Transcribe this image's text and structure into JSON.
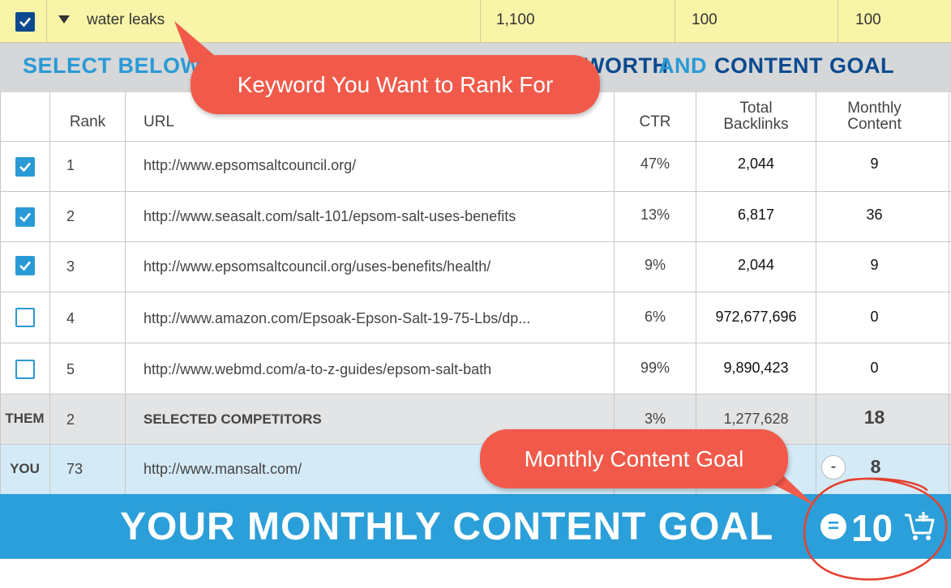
{
  "keyword_row": {
    "keyword": "water leaks",
    "search_volume": "1,100",
    "col3": "100",
    "col4": "100"
  },
  "banner": {
    "left_text": "SELECT BELOW",
    "right_part1": "WORTH",
    "right_and": "AND",
    "right_part2": "CONTENT GOAL"
  },
  "table": {
    "headers": {
      "rank": "Rank",
      "url": "URL",
      "ctr": "CTR",
      "backlinks_l1": "Total",
      "backlinks_l2": "Backlinks",
      "content_l1": "Monthly",
      "content_l2": "Content"
    },
    "rows": [
      {
        "checked": true,
        "rank": "1",
        "url": "http://www.epsomsaltcouncil.org/",
        "ctr": "47%",
        "backlinks": "2,044",
        "content": "9"
      },
      {
        "checked": true,
        "rank": "2",
        "url": "http://www.seasalt.com/salt-101/epsom-salt-uses-benefits",
        "ctr": "13%",
        "backlinks": "6,817",
        "content": "36"
      },
      {
        "checked": true,
        "rank": "3",
        "url": "http://www.epsomsaltcouncil.org/uses-benefits/health/",
        "ctr": "9%",
        "backlinks": "2,044",
        "content": "9"
      },
      {
        "checked": false,
        "rank": "4",
        "url": "http://www.amazon.com/Epsoak-Epson-Salt-19-75-Lbs/dp...",
        "ctr": "6%",
        "backlinks": "972,677,696",
        "content": "0"
      },
      {
        "checked": false,
        "rank": "5",
        "url": "http://www.webmd.com/a-to-z-guides/epsom-salt-bath",
        "ctr": "99%",
        "backlinks": "9,890,423",
        "content": "0"
      }
    ],
    "them": {
      "label": "THEM",
      "rank": "2",
      "url": "SELECTED COMPETITORS",
      "ctr": "3%",
      "backlinks": "1,277,628",
      "content": "18"
    },
    "you": {
      "label": "YOU",
      "rank": "73",
      "url": "http://www.mansalt.com/",
      "minus": "-",
      "content": "8"
    }
  },
  "goal": {
    "label": "YOUR MONTHLY CONTENT GOAL",
    "equals": "=",
    "value": "10"
  },
  "callouts": {
    "keyword": "Keyword You Want to Rank For",
    "goal": "Monthly Content Goal"
  },
  "colors": {
    "accent_blue": "#2b9fd9",
    "dark_blue": "#0b4a8f",
    "callout_red": "#f15a4a",
    "keyword_yellow": "#f8f4a8"
  }
}
